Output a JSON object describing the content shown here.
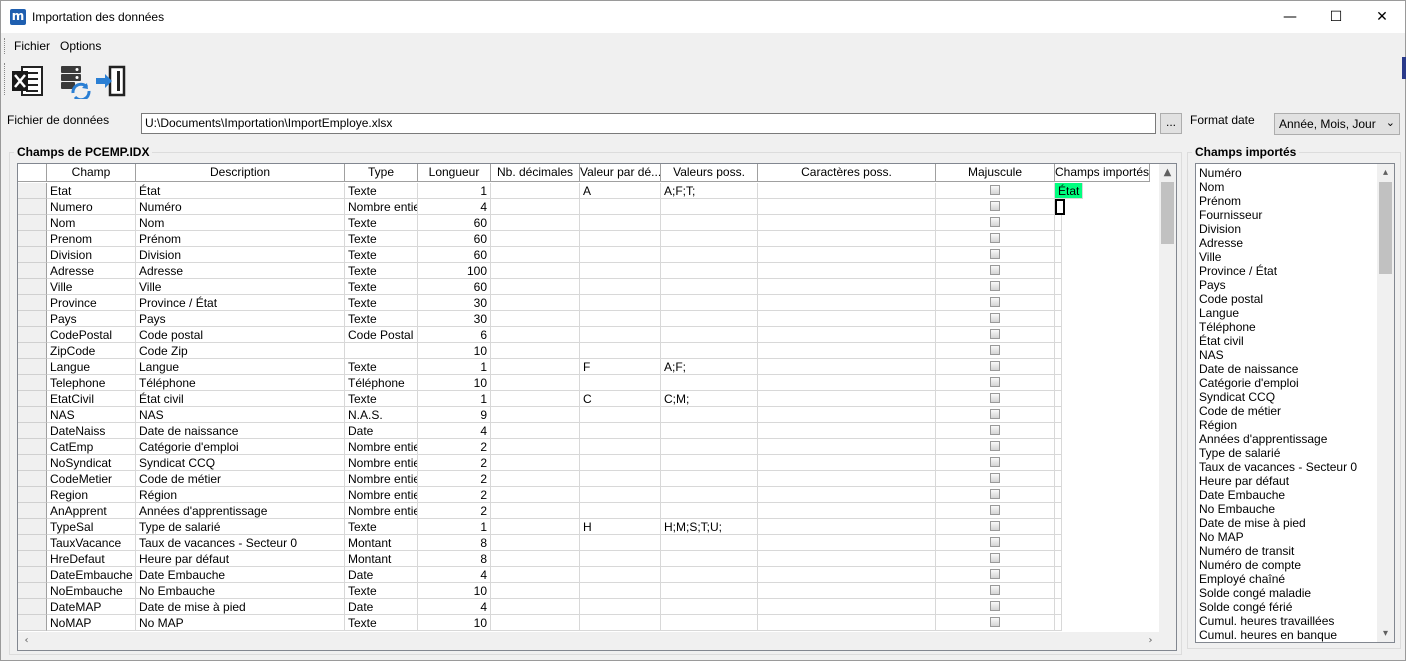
{
  "window": {
    "title": "Importation des données",
    "icon_letter": "m",
    "minimize": "—",
    "maximize": "☐",
    "close": "✕"
  },
  "menu": {
    "items": [
      "Fichier",
      "Options"
    ]
  },
  "toolbar": {
    "icons": [
      "excel-icon",
      "database-refresh-icon",
      "exit-icon"
    ]
  },
  "file": {
    "label": "Fichier de données",
    "value": "U:\\Documents\\Importation\\ImportEmploye.xlsx",
    "browse_label": "..."
  },
  "date_format": {
    "label": "Format date",
    "selected": "Année, Mois, Jour",
    "arrow": "⌄"
  },
  "fields_group": {
    "title": "Champs de PCEMP.IDX"
  },
  "imported_group": {
    "title": "Champs importés"
  },
  "grid": {
    "headers": [
      "Champ",
      "Description",
      "Type",
      "Longueur",
      "Nb. décimales",
      "Valeur par dé...",
      "Valeurs poss.",
      "Caractères poss.",
      "Majuscule",
      "Champs importés"
    ],
    "rows": [
      [
        "Etat",
        "État",
        "Texte",
        "1",
        "",
        "A",
        "A;F;T;",
        "",
        "État"
      ],
      [
        "Numero",
        "Numéro",
        "Nombre entier",
        "4",
        "",
        "",
        "",
        "",
        ""
      ],
      [
        "Nom",
        "Nom",
        "Texte",
        "60",
        "",
        "",
        "",
        "",
        ""
      ],
      [
        "Prenom",
        "Prénom",
        "Texte",
        "60",
        "",
        "",
        "",
        "",
        ""
      ],
      [
        "Division",
        "Division",
        "Texte",
        "60",
        "",
        "",
        "",
        "",
        ""
      ],
      [
        "Adresse",
        "Adresse",
        "Texte",
        "100",
        "",
        "",
        "",
        "",
        ""
      ],
      [
        "Ville",
        "Ville",
        "Texte",
        "60",
        "",
        "",
        "",
        "",
        ""
      ],
      [
        "Province",
        "Province / État",
        "Texte",
        "30",
        "",
        "",
        "",
        "",
        ""
      ],
      [
        "Pays",
        "Pays",
        "Texte",
        "30",
        "",
        "",
        "",
        "",
        ""
      ],
      [
        "CodePostal",
        "Code postal",
        "Code Postal",
        "6",
        "",
        "",
        "",
        "",
        ""
      ],
      [
        "ZipCode",
        "Code Zip",
        "",
        "10",
        "",
        "",
        "",
        "",
        ""
      ],
      [
        "Langue",
        "Langue",
        "Texte",
        "1",
        "",
        "F",
        "A;F;",
        "",
        ""
      ],
      [
        "Telephone",
        "Téléphone",
        "Téléphone",
        "10",
        "",
        "",
        "",
        "",
        ""
      ],
      [
        "EtatCivil",
        "État civil",
        "Texte",
        "1",
        "",
        "C",
        "C;M;",
        "",
        ""
      ],
      [
        "NAS",
        "NAS",
        "N.A.S.",
        "9",
        "",
        "",
        "",
        "",
        ""
      ],
      [
        "DateNaiss",
        "Date de naissance",
        "Date",
        "4",
        "",
        "",
        "",
        "",
        ""
      ],
      [
        "CatEmp",
        "Catégorie d'emploi",
        "Nombre entier",
        "2",
        "",
        "",
        "",
        "",
        ""
      ],
      [
        "NoSyndicat",
        "Syndicat CCQ",
        "Nombre entier",
        "2",
        "",
        "",
        "",
        "",
        ""
      ],
      [
        "CodeMetier",
        "Code de métier",
        "Nombre entier",
        "2",
        "",
        "",
        "",
        "",
        ""
      ],
      [
        "Region",
        "Région",
        "Nombre entier",
        "2",
        "",
        "",
        "",
        "",
        ""
      ],
      [
        "AnApprent",
        "Années d'apprentissage",
        "Nombre entier",
        "2",
        "",
        "",
        "",
        "",
        ""
      ],
      [
        "TypeSal",
        "Type de salarié",
        "Texte",
        "1",
        "",
        "H",
        "H;M;S;T;U;",
        "",
        ""
      ],
      [
        "TauxVacance",
        "Taux de vacances - Secteur 0",
        "Montant",
        "8",
        "",
        "",
        "",
        "",
        ""
      ],
      [
        "HreDefaut",
        "Heure par défaut",
        "Montant",
        "8",
        "",
        "",
        "",
        "",
        ""
      ],
      [
        "DateEmbauche",
        "Date Embauche",
        "Date",
        "4",
        "",
        "",
        "",
        "",
        ""
      ],
      [
        "NoEmbauche",
        "No Embauche",
        "Texte",
        "10",
        "",
        "",
        "",
        "",
        ""
      ],
      [
        "DateMAP",
        "Date de mise à pied",
        "Date",
        "4",
        "",
        "",
        "",
        "",
        ""
      ],
      [
        "NoMAP",
        "No MAP",
        "Texte",
        "10",
        "",
        "",
        "",
        "",
        ""
      ]
    ],
    "selected_color": "#00ff7f"
  },
  "imported_list": [
    "Numéro",
    "Nom",
    "Prénom",
    "Fournisseur",
    "Division",
    "Adresse",
    "Ville",
    "Province / État",
    "Pays",
    "Code postal",
    "Langue",
    "Téléphone",
    "État civil",
    "NAS",
    "Date de naissance",
    "Catégorie d'emploi",
    "Syndicat CCQ",
    "Code de métier",
    "Région",
    "Années d'apprentissage",
    "Type de salarié",
    "Taux de vacances - Secteur 0",
    "Heure par défaut",
    "Date Embauche",
    "No Embauche",
    "Date de mise à pied",
    "No MAP",
    "Numéro de transit",
    "Numéro de compte",
    "Employé chaîné",
    "Solde congé maladie",
    "Solde congé férié",
    "Cumul. heures travaillées",
    "Cumul. heures en banque"
  ]
}
